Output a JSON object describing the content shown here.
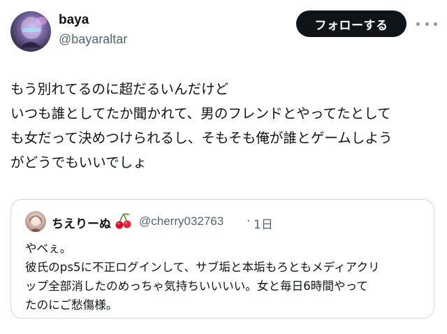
{
  "author": {
    "display_name": "baya",
    "handle": "@bayaraltar",
    "avatar_icon": "profile-avatar"
  },
  "actions": {
    "follow_label": "フォローする",
    "more_icon": "more-horizontal-icon"
  },
  "post": {
    "lines": [
      "もう別れてるのに超だるいんだけど",
      "いつも誰としてたか聞かれて、男のフレンドとやってたとして",
      "も女だって決めつけられるし、そもそも俺が誰とゲームしよう",
      "がどうでもいいでしょ"
    ]
  },
  "quote": {
    "display_name": "ちえりーぬ",
    "name_emoji": "🍒",
    "handle": "@cherry032763",
    "separator": "·",
    "time": "1日",
    "lines": [
      "やべぇ。",
      "彼氏のps5に不正ログインして、サブ垢と本垢もろともメディアクリ",
      "ップ全部消したのめっちゃ気持ちいいいい。女と毎日6時間やって",
      "たのにご愁傷様。"
    ]
  },
  "colors": {
    "text_primary": "#0f1419",
    "text_secondary": "#536471",
    "button_bg": "#0f1419",
    "border": "#cfd9de"
  }
}
